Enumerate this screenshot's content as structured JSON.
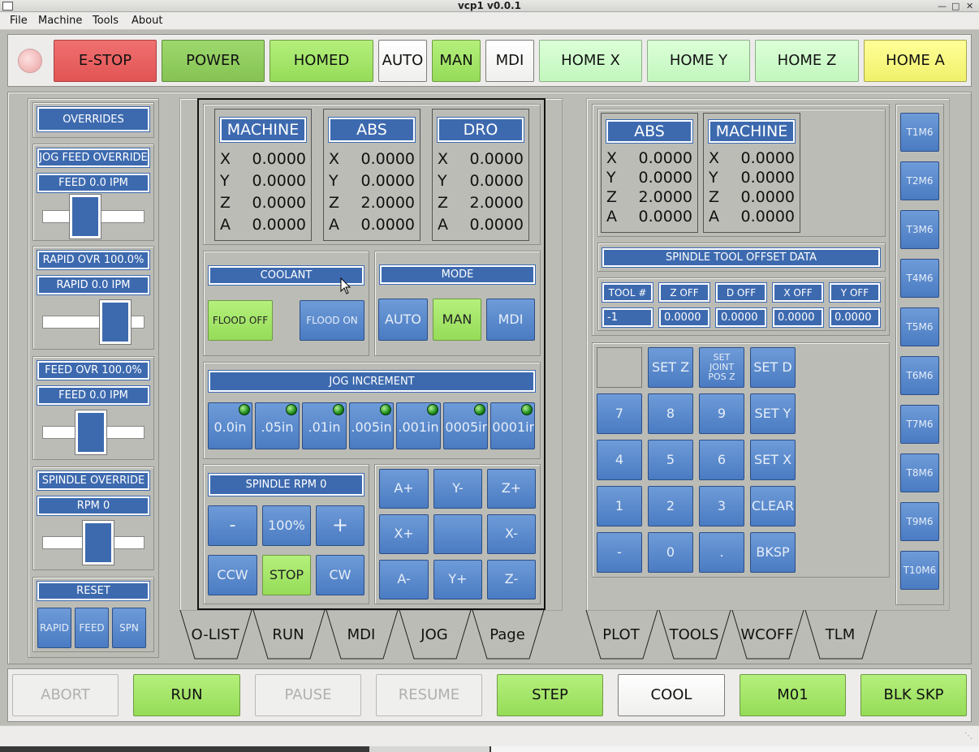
{
  "window": {
    "title": "vcp1 v0.0.1"
  },
  "menu": [
    "File",
    "Machine",
    "Tools",
    "About"
  ],
  "top_bar": {
    "estop": "E-STOP",
    "power": "POWER",
    "homed": "HOMED",
    "auto": "AUTO",
    "man": "MAN",
    "mdi": "MDI",
    "home_x": "HOME X",
    "home_y": "HOME Y",
    "home_z": "HOME Z",
    "home_a": "HOME A"
  },
  "overrides": {
    "title": "OVERRIDES",
    "jog_feed_override": "JOG FEED OVERRIDE",
    "jog_feed_value": "FEED 0.0  IPM",
    "jog_feed_level": 0.42,
    "rapid_ovr": "RAPID OVR 100.0%",
    "rapid_value": "RAPID 0.0  IPM",
    "rapid_level": 0.84,
    "feed_ovr": "FEED OVR 100.0%",
    "feed_value": "FEED 0.0  IPM",
    "feed_level": 0.5,
    "spindle_override": "SPINDLE OVERRIDE",
    "spindle_value": "RPM 0",
    "spindle_level": 0.6,
    "reset": "RESET",
    "reset_rapid": "RAPID",
    "reset_feed": "FEED",
    "reset_spn": "SPN"
  },
  "dro_center": [
    {
      "title": "MACHINE",
      "rows": [
        [
          "X",
          "0.0000"
        ],
        [
          "Y",
          "0.0000"
        ],
        [
          "Z",
          "0.0000"
        ],
        [
          "A",
          "0.0000"
        ]
      ]
    },
    {
      "title": "ABS",
      "rows": [
        [
          "X",
          "0.0000"
        ],
        [
          "Y",
          "0.0000"
        ],
        [
          "Z",
          "2.0000"
        ],
        [
          "A",
          "0.0000"
        ]
      ]
    },
    {
      "title": "DRO",
      "rows": [
        [
          "X",
          "0.0000"
        ],
        [
          "Y",
          "0.0000"
        ],
        [
          "Z",
          "2.0000"
        ],
        [
          "A",
          "0.0000"
        ]
      ]
    }
  ],
  "coolant": {
    "title": "COOLANT",
    "flood_off": "FLOOD OFF",
    "flood_on": "FLOOD ON"
  },
  "mode": {
    "title": "MODE",
    "auto": "AUTO",
    "man": "MAN",
    "mdi": "MDI"
  },
  "jog_increment": {
    "title": "JOG INCREMENT",
    "items": [
      "0.0in",
      ".05in",
      ".01in",
      ".005in",
      ".001in",
      ".0005in",
      ".0001in"
    ]
  },
  "spindle": {
    "title": "SPINDLE RPM 0",
    "minus": "-",
    "pct": "100%",
    "plus": "+",
    "ccw": "CCW",
    "stop": "STOP",
    "cw": "CW"
  },
  "jog_pad": [
    "A+",
    "Y-",
    "Z+",
    "X+",
    "",
    "X-",
    "A-",
    "Y+",
    "Z-"
  ],
  "left_tabs": [
    "O-LIST",
    "RUN",
    "MDI",
    "JOG",
    "Page"
  ],
  "right_tabs": [
    "PLOT",
    "TOOLS",
    "WCOFF",
    "TLM"
  ],
  "dro_right": [
    {
      "title": "ABS",
      "rows": [
        [
          "X",
          "0.0000"
        ],
        [
          "Y",
          "0.0000"
        ],
        [
          "Z",
          "2.0000"
        ],
        [
          "A",
          "0.0000"
        ]
      ]
    },
    {
      "title": "MACHINE",
      "rows": [
        [
          "X",
          "0.0000"
        ],
        [
          "Y",
          "0.0000"
        ],
        [
          "Z",
          "0.0000"
        ],
        [
          "A",
          "0.0000"
        ]
      ]
    }
  ],
  "tool_offset": {
    "title": "SPINDLE TOOL OFFSET DATA",
    "headers": [
      "TOOL #",
      "Z OFF",
      "D OFF",
      "X OFF",
      "Y OFF"
    ],
    "values": [
      "-1",
      "0.0000",
      "0.0000",
      "0.0000",
      "0.0000"
    ]
  },
  "keypad": {
    "set_z": "SET Z",
    "set_joint_pos_z": "SET JOINT POS Z",
    "set_d": "SET D",
    "k7": "7",
    "k8": "8",
    "k9": "9",
    "set_y": "SET Y",
    "k4": "4",
    "k5": "5",
    "k6": "6",
    "set_x": "SET X",
    "k1": "1",
    "k2": "2",
    "k3": "3",
    "clear": "CLEAR",
    "neg": "-",
    "k0": "0",
    "dot": ".",
    "bksp": "BKSP"
  },
  "tool_buttons": [
    "T1M6",
    "T2M6",
    "T3M6",
    "T4M6",
    "T5M6",
    "T6M6",
    "T7M6",
    "T8M6",
    "T9M6",
    "T10M6"
  ],
  "bottom_bar": {
    "abort": "ABORT",
    "run": "RUN",
    "pause": "PAUSE",
    "resume": "RESUME",
    "step": "STEP",
    "cool": "COOL",
    "m01": "M01",
    "blk_skp": "BLK SKP"
  },
  "colors": {
    "accent_blue": "#3d6aaf",
    "active_green": "#96dc58",
    "estop_red": "#e25454",
    "home_a_yellow": "#f0f06c"
  }
}
